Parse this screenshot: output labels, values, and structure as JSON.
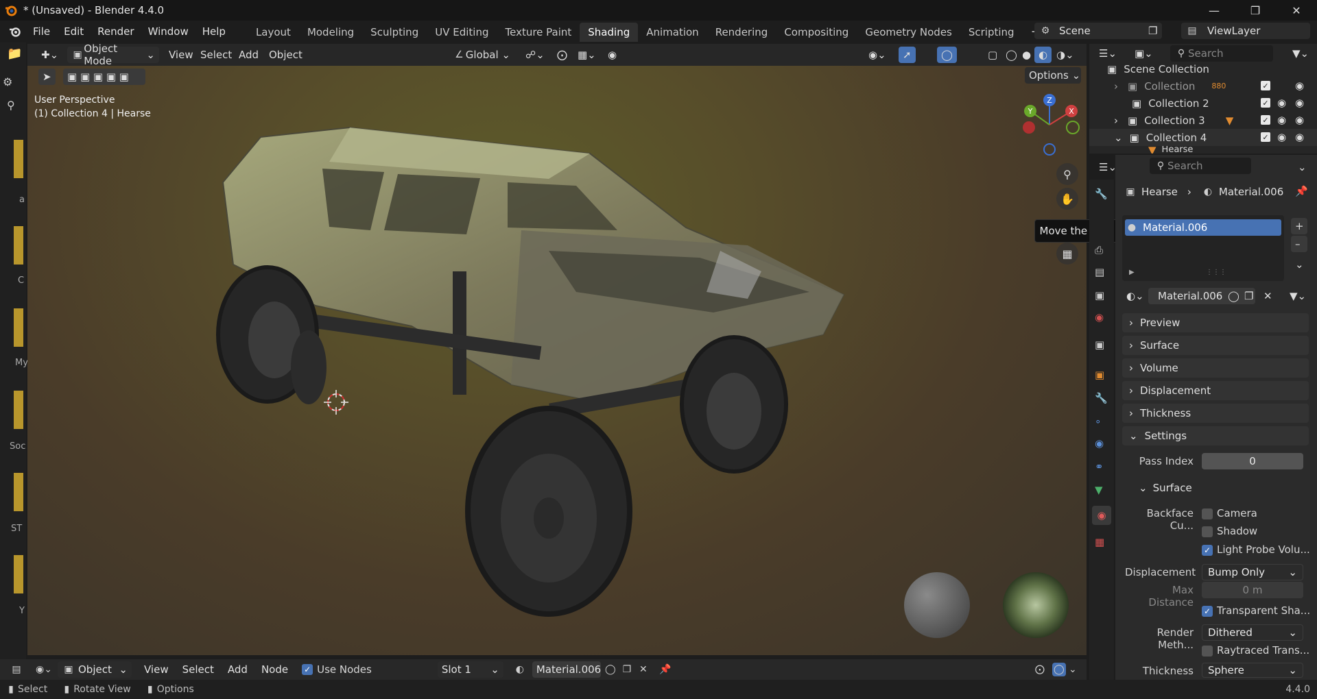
{
  "window": {
    "title": "* (Unsaved) - Blender 4.4.0"
  },
  "menu": [
    "File",
    "Edit",
    "Render",
    "Window",
    "Help"
  ],
  "workspaces": [
    "Layout",
    "Modeling",
    "Sculpting",
    "UV Editing",
    "Texture Paint",
    "Shading",
    "Animation",
    "Rendering",
    "Compositing",
    "Geometry Nodes",
    "Scripting"
  ],
  "active_workspace": "Shading",
  "scene": {
    "name": "Scene",
    "view_layer": "ViewLayer"
  },
  "viewport_header": {
    "mode": "Object Mode",
    "menus": [
      "View",
      "Select",
      "Add",
      "Object"
    ],
    "transform": "Global",
    "options": "Options"
  },
  "viewport": {
    "view_name": "User Perspective",
    "context": "(1) Collection 4 | Hearse",
    "tooltip": "Move the view"
  },
  "gizmo": {
    "z": "Z",
    "y": "Y",
    "x": "X"
  },
  "outliner": {
    "search_placeholder": "Search",
    "root": "Scene Collection",
    "rows": [
      {
        "name": "Collection",
        "badge": "880"
      },
      {
        "name": "Collection 2",
        "badge": ""
      },
      {
        "name": "Collection 3",
        "badge": ""
      },
      {
        "name": "Collection 4",
        "badge": ""
      },
      {
        "name": "Hearse",
        "badge": ""
      }
    ]
  },
  "properties": {
    "search_placeholder": "Search",
    "breadcrumb": {
      "object": "Hearse",
      "material": "Material.006"
    },
    "slot_item": "Material.006",
    "material_name": "Material.006",
    "panels": [
      "Preview",
      "Surface",
      "Volume",
      "Displacement",
      "Thickness",
      "Settings"
    ],
    "settings": {
      "pass_index_label": "Pass Index",
      "pass_index_value": "0",
      "surface_sub": "Surface",
      "backface_label": "Backface Cu...",
      "camera": "Camera",
      "shadow": "Shadow",
      "light_probe": "Light Probe Volu...",
      "displacement_label": "Displacement",
      "displacement_value": "Bump Only",
      "max_distance_label": "Max Distance",
      "max_distance_value": "0 m",
      "transparent": "Transparent Sha...",
      "render_method_label": "Render Meth...",
      "render_method_value": "Dithered",
      "raytraced": "Raytraced Trans...",
      "thickness_label": "Thickness",
      "thickness_value": "Sphere"
    }
  },
  "node_header": {
    "object": "Object",
    "menus": [
      "View",
      "Select",
      "Add",
      "Node"
    ],
    "use_nodes": "Use Nodes",
    "slot": "Slot 1",
    "material": "Material.006"
  },
  "statusbar": {
    "select": "Select",
    "rotate": "Rotate View",
    "options": "Options",
    "version": "4.4.0"
  },
  "left_strip_labels": [
    "a",
    "C",
    "My",
    "Soc",
    "ST",
    "Y"
  ]
}
